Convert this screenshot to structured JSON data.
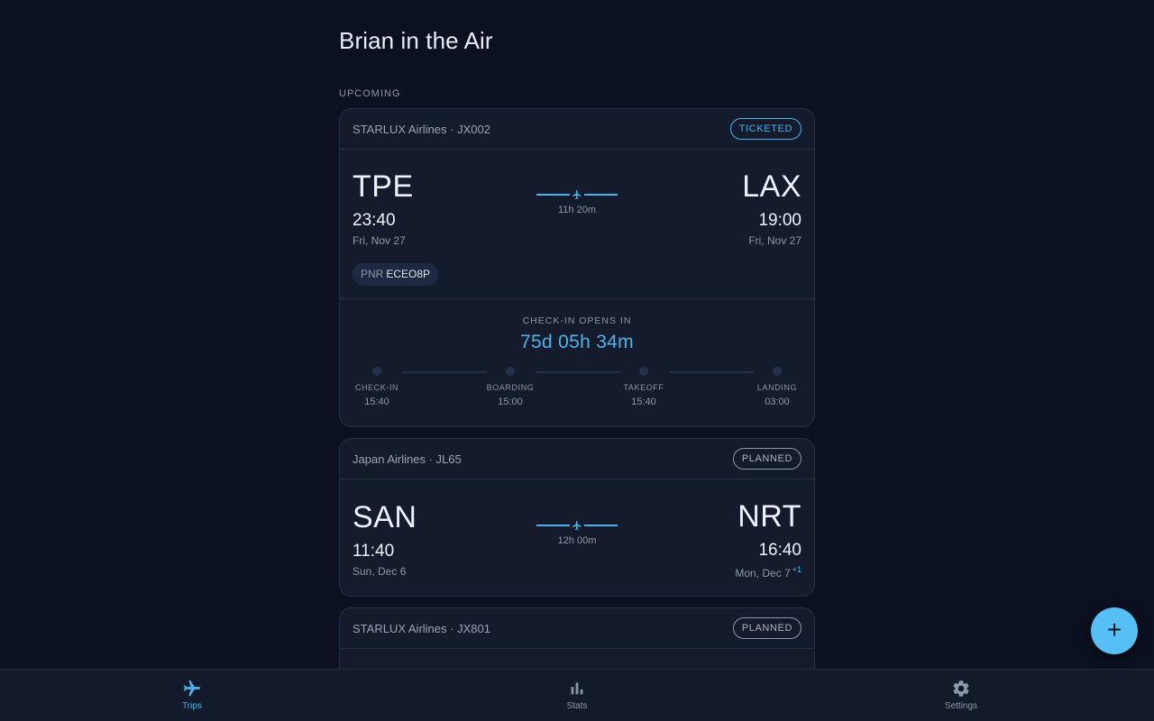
{
  "page": {
    "title": "Brian in the Air"
  },
  "upcoming_label": "UPCOMING",
  "flights": [
    {
      "airline": "STARLUX Airlines · JX002",
      "status": "TICKETED",
      "origin": {
        "code": "TPE",
        "time": "23:40",
        "date": "Fri, Nov 27"
      },
      "destination": {
        "code": "LAX",
        "time": "19:00",
        "date": "Fri, Nov 27"
      },
      "duration": "11h 20m",
      "pnr_label": "PNR",
      "pnr": "ECEO8P",
      "checkin": {
        "label": "CHECK-IN OPENS IN",
        "countdown": "75d 05h 34m",
        "steps": [
          {
            "label": "CHECK-IN",
            "time": "15:40"
          },
          {
            "label": "BOARDING",
            "time": "15:00"
          },
          {
            "label": "TAKEOFF",
            "time": "15:40"
          },
          {
            "label": "LANDING",
            "time": "03:00"
          }
        ]
      }
    },
    {
      "airline": "Japan Airlines · JL65",
      "status": "PLANNED",
      "origin": {
        "code": "SAN",
        "time": "11:40",
        "date": "Sun, Dec 6"
      },
      "destination": {
        "code": "NRT",
        "time": "16:40",
        "date": "Mon, Dec 7",
        "day_offset": "+1"
      },
      "duration": "12h 00m"
    },
    {
      "airline": "STARLUX Airlines · JX801",
      "status": "PLANNED"
    }
  ],
  "fab": {
    "label": "+"
  },
  "nav": [
    {
      "label": "Trips",
      "icon": "airplane-icon",
      "active": true
    },
    {
      "label": "Stats",
      "icon": "bar-chart-icon",
      "active": false
    },
    {
      "label": "Settings",
      "icon": "gear-icon",
      "active": false
    }
  ],
  "colors": {
    "background": "#0b1120",
    "card": "#141b2d",
    "accent": "#4fb3e8",
    "fab": "#56bff5",
    "muted": "#8c97ab"
  }
}
